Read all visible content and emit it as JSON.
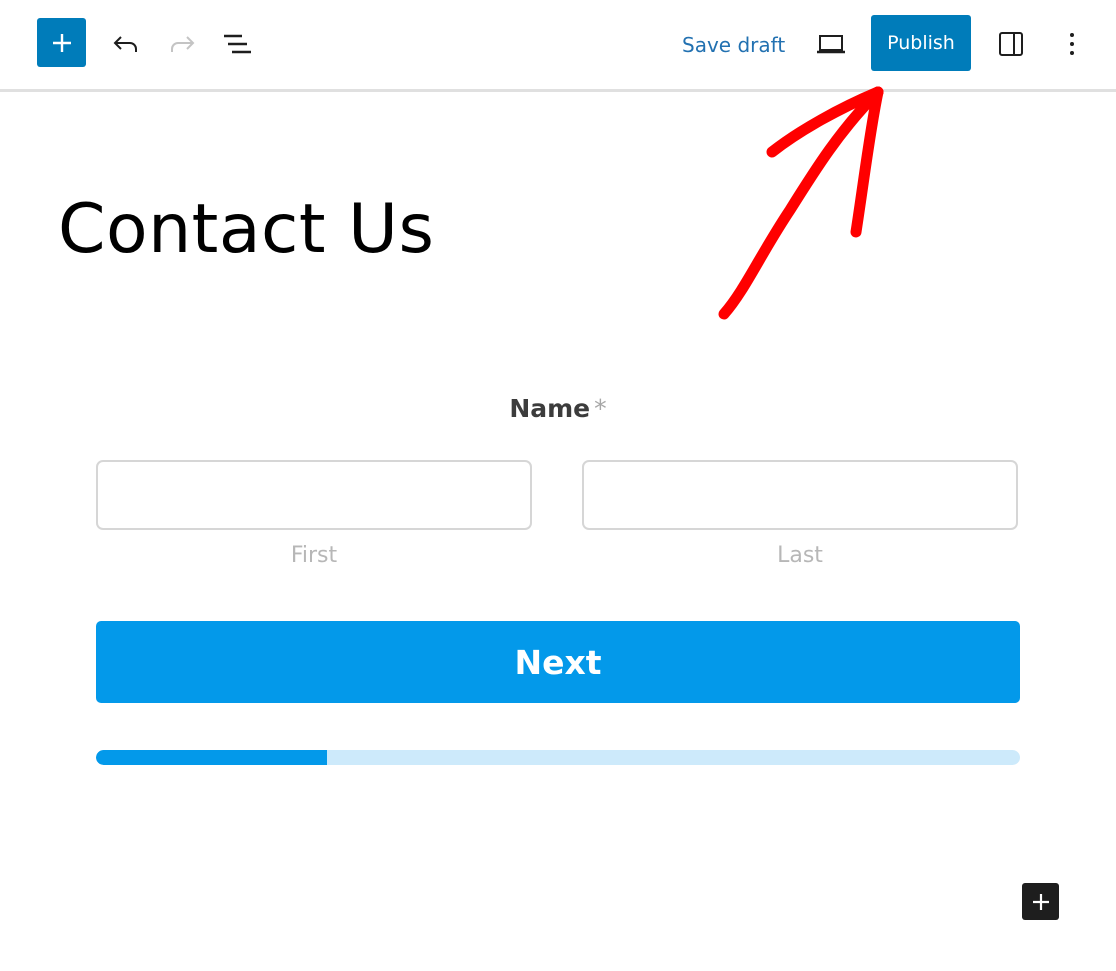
{
  "toolbar": {
    "inserter_icon": "plus-icon",
    "undo_icon": "undo-icon",
    "redo_icon": "redo-icon",
    "redo_enabled": false,
    "list_view_icon": "list-view-icon",
    "save_draft_label": "Save draft",
    "preview_icon": "laptop-icon",
    "publish_label": "Publish",
    "settings_icon": "sidebar-toggle-icon",
    "options_icon": "more-vertical-icon"
  },
  "page": {
    "title": "Contact Us"
  },
  "form": {
    "name_field": {
      "label": "Name",
      "required_mark": "*",
      "first": {
        "value": "",
        "placeholder": "",
        "sublabel": "First"
      },
      "last": {
        "value": "",
        "placeholder": "",
        "sublabel": "Last"
      }
    },
    "next_button_label": "Next",
    "progress": {
      "fraction": 0.25
    }
  },
  "block_appender_icon": "plus-icon",
  "annotation": {
    "type": "hand-drawn arrow",
    "points_to": "Publish",
    "color": "#ff0000"
  },
  "colors": {
    "wp_accent": "#007cba",
    "form_accent": "#0399ea",
    "progress_track": "#cdeafb",
    "annotation": "#ff0000"
  }
}
